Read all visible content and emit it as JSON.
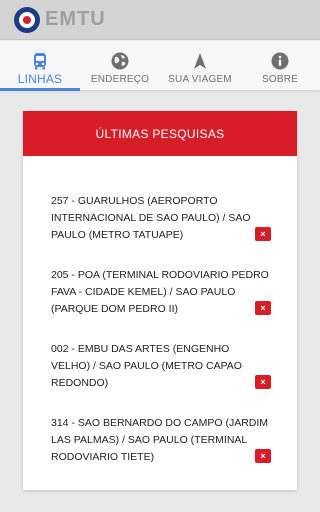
{
  "app": {
    "logo_text": "EMTU",
    "brand_colors": {
      "red": "#d71e28",
      "blue": "#1f3b86",
      "accent": "#4a86d8"
    }
  },
  "tabs": [
    {
      "label": "LINHAS",
      "icon": "bus-icon",
      "active": true
    },
    {
      "label": "ENDEREÇO",
      "icon": "globe-icon",
      "active": false
    },
    {
      "label": "SUA VIAGEM",
      "icon": "navigation-arrow-icon",
      "active": false
    },
    {
      "label": "SOBRE",
      "icon": "info-icon",
      "active": false
    }
  ],
  "recent": {
    "title": "ÚLTIMAS PESQUISAS",
    "remove_label": "×",
    "items": [
      {
        "text": "257 - GUARULHOS (AEROPORTO INTERNACIONAL DE SAO PAULO) / SAO PAULO (METRO TATUAPE)"
      },
      {
        "text": "205 - POA (TERMINAL RODOVIARIO PEDRO FAVA - CIDADE KEMEL) / SAO PAULO (PARQUE DOM PEDRO II)"
      },
      {
        "text": "002 - EMBU DAS ARTES (ENGENHO VELHO) / SAO PAULO (METRO CAPAO REDONDO)"
      },
      {
        "text": "314 - SAO BERNARDO DO CAMPO (JARDIM LAS PALMAS) / SAO PAULO (TERMINAL RODOVIARIO TIETE)"
      }
    ]
  }
}
